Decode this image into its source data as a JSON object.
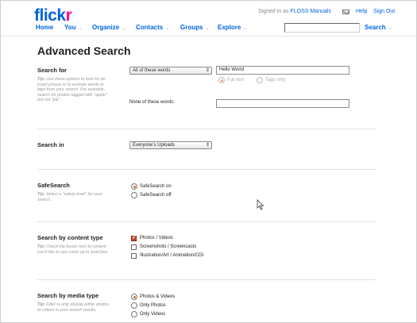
{
  "header": {
    "logo_main": "flick",
    "logo_accent": "r",
    "signed_in_prefix": "Signed in as",
    "user_name": "FLOSS Manuals",
    "help": "Help",
    "sign_out": "Sign Out"
  },
  "nav": {
    "items": [
      {
        "label": "Home",
        "has_menu": false
      },
      {
        "label": "You",
        "has_menu": true
      },
      {
        "label": "Organize",
        "has_menu": true
      },
      {
        "label": "Contacts",
        "has_menu": true
      },
      {
        "label": "Groups",
        "has_menu": true
      },
      {
        "label": "Explore",
        "has_menu": true
      }
    ],
    "search_label": "Search",
    "search_value": ""
  },
  "page_title": "Advanced Search",
  "search_for": {
    "title": "Search for",
    "tip_bold": "Tip:",
    "tip": "Use these options to look for an exact phrase or to exclude words or tags from your search. For example, search for photos tagged with \"apple\" but not \"pie\".",
    "mode_selected": "All of these words",
    "query_value": "Hello World",
    "full_text_label": "Full text",
    "tags_only_label": "Tags only",
    "none_label": "None of these words:",
    "none_value": ""
  },
  "search_in": {
    "title": "Search in",
    "selected": "Everyone's Uploads"
  },
  "safesearch": {
    "title": "SafeSearch",
    "tip_bold": "Tip:",
    "tip": "Select a \"safety level\" for your search.",
    "options": [
      "SafeSearch on",
      "SafeSearch off"
    ],
    "selected_index": 0
  },
  "content_type": {
    "title": "Search by content type",
    "tip_bold": "Tip:",
    "tip": "Check the boxes next to content you'd like to see come up in searches.",
    "options": [
      {
        "label": "Photos / Videos",
        "checked": true
      },
      {
        "label": "Screenshots / Screencasts",
        "checked": false
      },
      {
        "label": "Illustration/Art / Animation/CGI",
        "checked": false
      }
    ]
  },
  "media_type": {
    "title": "Search by media type",
    "tip_bold": "Tip:",
    "tip": "Filter to only display either photos or videos in your search results.",
    "options": [
      "Photos & Videos",
      "Only Photos",
      "Only Videos"
    ],
    "selected_index": 0
  }
}
